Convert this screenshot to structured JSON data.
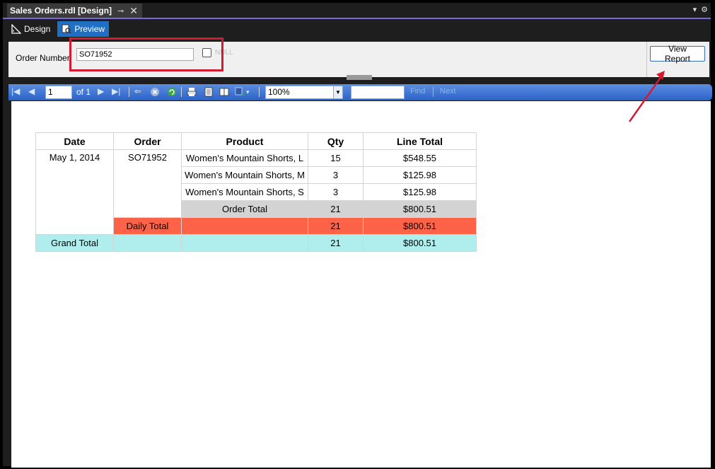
{
  "document_tab": {
    "title": "Sales Orders.rdl [Design]"
  },
  "mode_tabs": [
    {
      "label": "Design"
    },
    {
      "label": "Preview"
    }
  ],
  "parameters": {
    "order_number_label": "Order Number",
    "order_number_value": "SO71952",
    "null_label": "NULL",
    "view_report_label": "View Report"
  },
  "toolbar": {
    "page_number": "1",
    "of_label": "of",
    "total_pages": "1",
    "zoom": "100%",
    "find_label": "Find",
    "next_label": "Next"
  },
  "report": {
    "headers": [
      "Date",
      "Order",
      "Product",
      "Qty",
      "Line Total"
    ],
    "date": "May 1, 2014",
    "order": "SO71952",
    "lines": [
      {
        "product": "Women's Mountain Shorts, L",
        "qty": "15",
        "total": "$548.55"
      },
      {
        "product": "Women's Mountain Shorts, M",
        "qty": "3",
        "total": "$125.98"
      },
      {
        "product": "Women's Mountain Shorts, S",
        "qty": "3",
        "total": "$125.98"
      }
    ],
    "order_total": {
      "label": "Order Total",
      "qty": "21",
      "total": "$800.51"
    },
    "daily_total": {
      "label": "Daily Total",
      "qty": "21",
      "total": "$800.51"
    },
    "grand_total": {
      "label": "Grand Total",
      "qty": "21",
      "total": "$800.51"
    }
  },
  "colors": {
    "order_total": "#d3d3d3",
    "daily_total": "#ff6347",
    "grand_total": "#b0eeee",
    "annotation": "#d41a2f"
  }
}
